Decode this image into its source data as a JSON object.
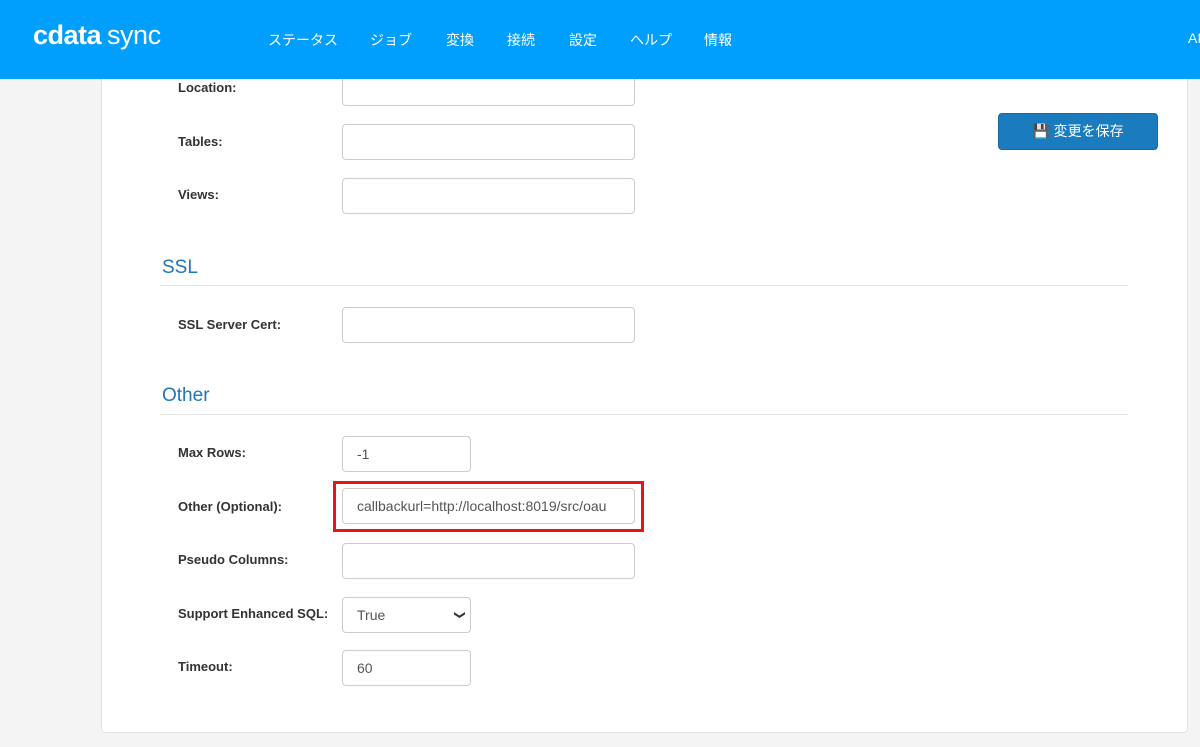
{
  "header": {
    "logo": {
      "brand": "cdata",
      "product": "sync"
    },
    "nav": [
      "ステータス",
      "ジョブ",
      "変換",
      "接続",
      "設定",
      "ヘルプ",
      "情報"
    ],
    "user_initials": "AI",
    "accent": "#009ffd"
  },
  "toolbar": {
    "save_label": "変更を保存",
    "save_icon": "floppy-disk-icon"
  },
  "fields_top": [
    {
      "label": "Location:",
      "value": ""
    },
    {
      "label": "Tables:",
      "value": ""
    },
    {
      "label": "Views:",
      "value": ""
    }
  ],
  "ssl": {
    "heading": "SSL",
    "fields": [
      {
        "label": "SSL Server Cert:",
        "value": ""
      }
    ]
  },
  "other": {
    "heading": "Other",
    "max_rows": {
      "label": "Max Rows:",
      "value": "-1"
    },
    "other_optional": {
      "label": "Other (Optional):",
      "value": "callbackurl=http://localhost:8019/src/oau"
    },
    "pseudo_columns": {
      "label": "Pseudo Columns:",
      "value": ""
    },
    "support_enhanced_sql": {
      "label": "Support Enhanced SQL:",
      "value": "True"
    },
    "timeout": {
      "label": "Timeout:",
      "value": "60"
    }
  }
}
